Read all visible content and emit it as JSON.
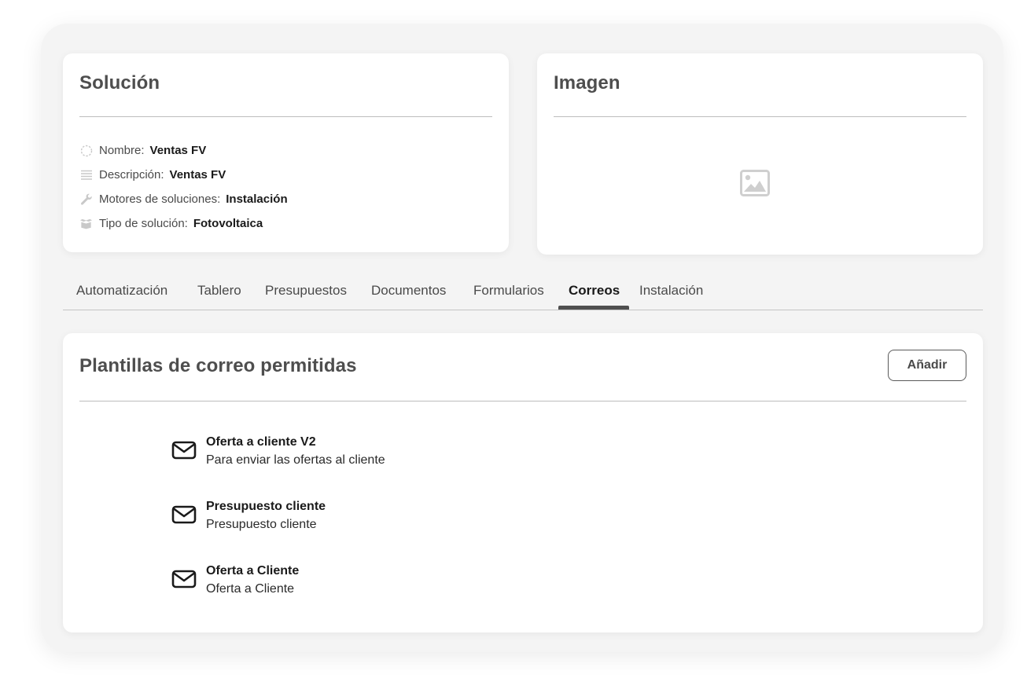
{
  "solution": {
    "title": "Solución",
    "fields": [
      {
        "icon": "dashed-circle-icon",
        "label": "Nombre:",
        "value": "Ventas FV"
      },
      {
        "icon": "lines-icon",
        "label": "Descripción:",
        "value": "Ventas FV"
      },
      {
        "icon": "wrench-icon",
        "label": "Motores de soluciones:",
        "value": "Instalación"
      },
      {
        "icon": "box-icon",
        "label": "Tipo de solución:",
        "value": "Fotovoltaica"
      }
    ]
  },
  "image_card": {
    "title": "Imagen",
    "placeholder_icon": "image-placeholder-icon"
  },
  "tabs": [
    {
      "label": "Automatización",
      "active": false
    },
    {
      "label": "Tablero",
      "active": false
    },
    {
      "label": "Presupuestos",
      "active": false
    },
    {
      "label": "Documentos",
      "active": false
    },
    {
      "label": "Formularios",
      "active": false
    },
    {
      "label": "Correos",
      "active": true
    },
    {
      "label": "Instalación",
      "active": false
    }
  ],
  "mail_templates": {
    "title": "Plantillas de correo permitidas",
    "add_label": "Añadir",
    "items": [
      {
        "icon": "envelope-icon",
        "title": "Oferta a cliente V2",
        "description": "Para enviar las ofertas al cliente"
      },
      {
        "icon": "envelope-icon",
        "title": "Presupuesto cliente",
        "description": "Presupuesto cliente"
      },
      {
        "icon": "envelope-icon",
        "title": "Oferta a Cliente",
        "description": "Oferta a Cliente"
      }
    ]
  },
  "colors": {
    "icon_grey": "#c9c9c9",
    "title_grey": "#4e4e4e",
    "tab_underline": "#4f4f4f"
  }
}
